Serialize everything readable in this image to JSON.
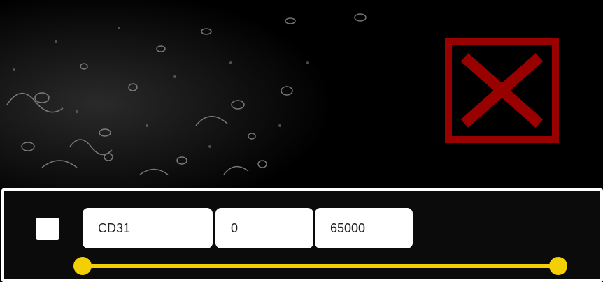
{
  "channel": {
    "name": "CD31",
    "min": "0",
    "max": "65000",
    "visible": false
  },
  "slider": {
    "range_min": 0,
    "range_max": 65000,
    "low_value": 0,
    "high_value": 65000,
    "color": "#f5cf05"
  },
  "colors": {
    "close_icon": "#990000",
    "panel_border": "#ffffff",
    "background": "#000000"
  }
}
